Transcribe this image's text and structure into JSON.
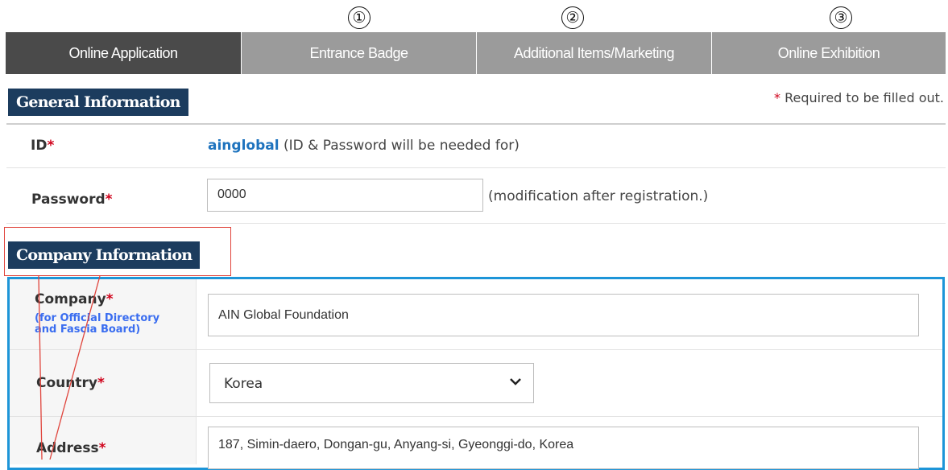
{
  "step_markers": [
    "①",
    "②",
    "③"
  ],
  "tabs": [
    {
      "label": "Online Application",
      "active": true
    },
    {
      "label": "Entrance Badge",
      "active": false
    },
    {
      "label": "Additional Items/Marketing",
      "active": false
    },
    {
      "label": "Online Exhibition",
      "active": false
    }
  ],
  "general": {
    "title": "General Information",
    "required_note": "Required to be filled out.",
    "required_mark": "*",
    "id_label": "ID",
    "id_value": "ainglobal",
    "id_hint": "(ID & Password will be needed for)",
    "password_label": "Password",
    "password_value": "0000",
    "password_hint": "(modification after registration.)"
  },
  "company": {
    "title": "Company Information",
    "company_label": "Company",
    "company_sub1": "(for Official Directory",
    "company_sub2": "and Fascia Board)",
    "company_value": "AIN Global Foundation",
    "country_label": "Country",
    "country_value": "Korea",
    "address_label": "Address",
    "address_value": "187, Simin-daero, Dongan-gu, Anyang-si, Gyeonggi-do, Korea"
  },
  "colors": {
    "active_tab": "#4a4a4a",
    "inactive_tab": "#9b9b9b",
    "section_title": "#1c3c5e",
    "required_star": "#d0021b",
    "id_link": "#1e73be",
    "highlight_border": "#1d95d8",
    "annotation": "#e0443c"
  },
  "icons": {
    "select_arrow": "chevron-down-icon"
  }
}
